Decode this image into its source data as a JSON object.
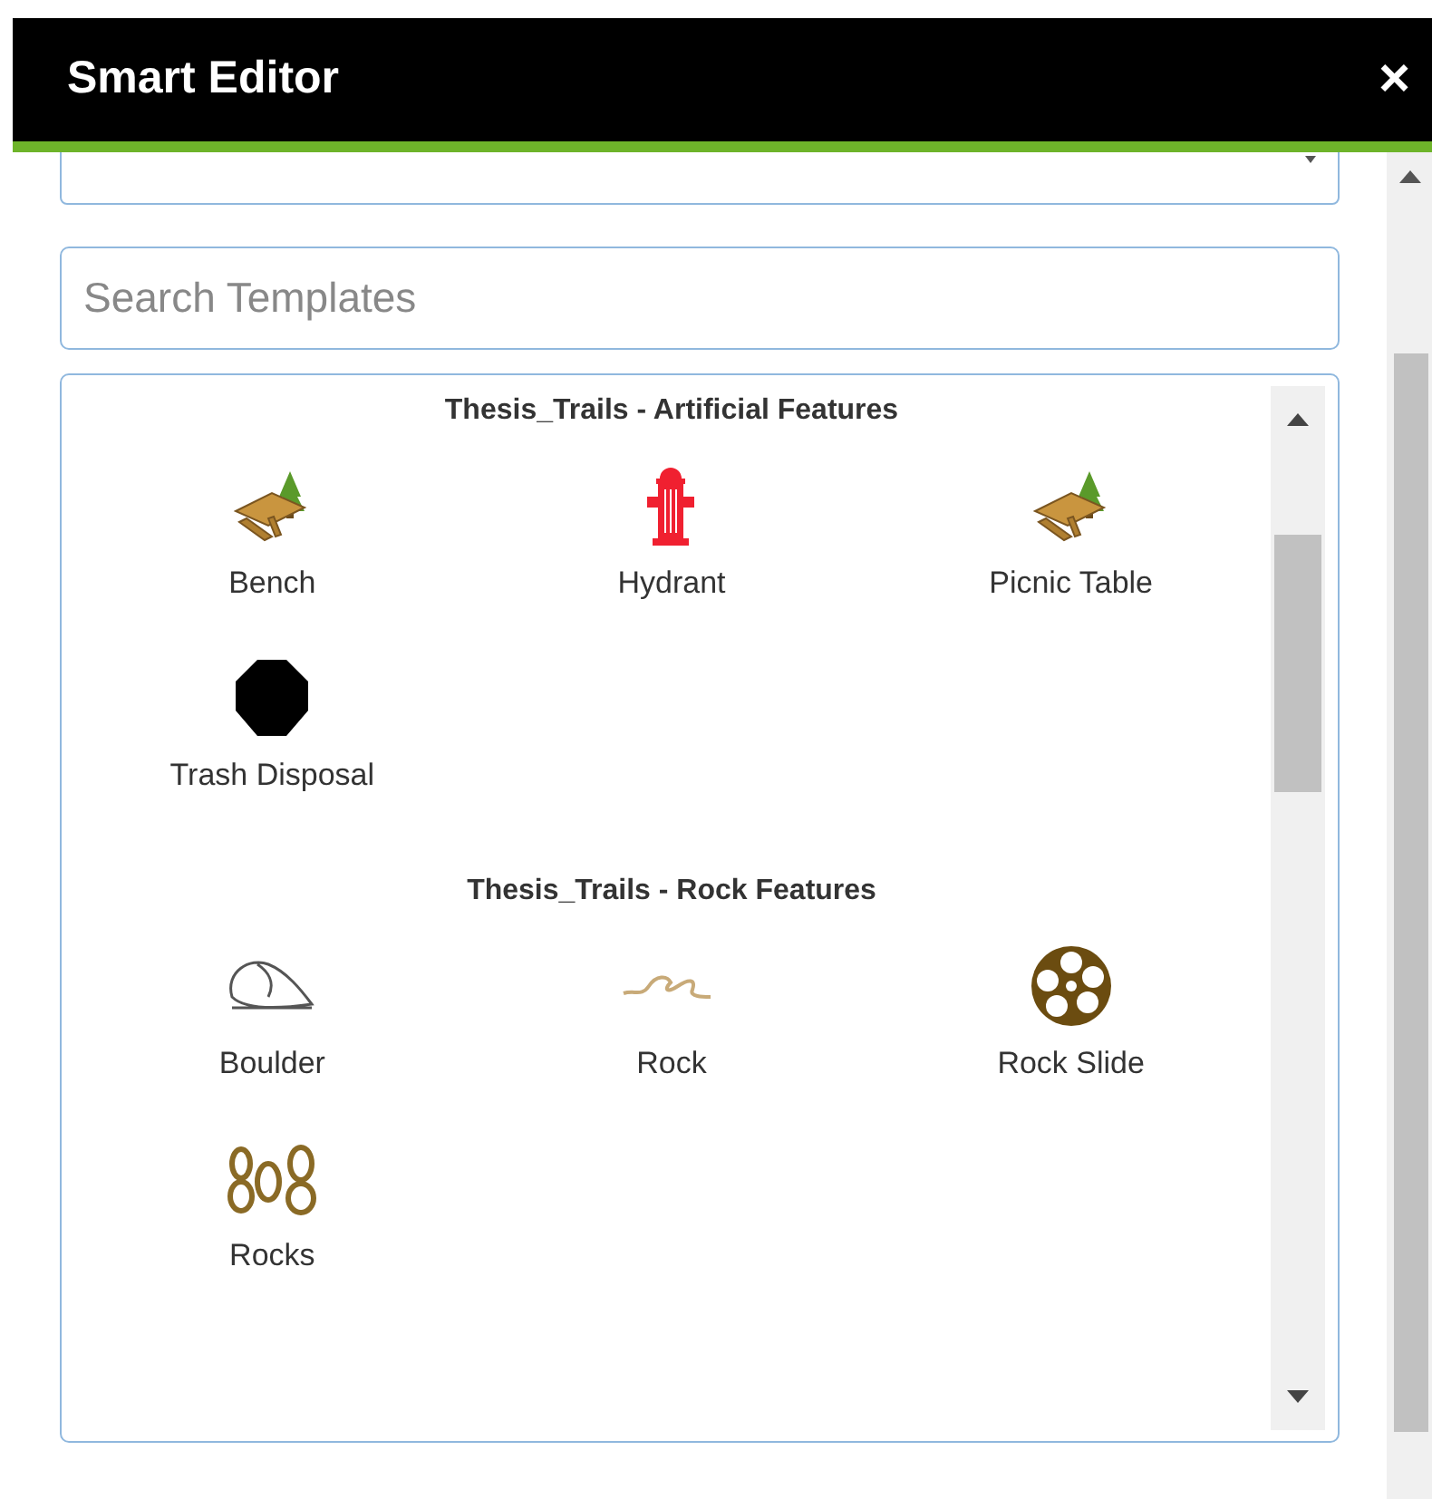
{
  "window": {
    "title": "Smart Editor",
    "close": "×"
  },
  "search": {
    "placeholder": "Search Templates"
  },
  "groups": [
    {
      "title": "Thesis_Trails - Artificial Features",
      "items": [
        {
          "label": "Bench",
          "kind": "picnic"
        },
        {
          "label": "Hydrant",
          "kind": "hydrant"
        },
        {
          "label": "Picnic Table",
          "kind": "picnic"
        },
        {
          "label": "Trash Disposal",
          "kind": "octagon"
        }
      ]
    },
    {
      "title": "Thesis_Trails - Rock Features",
      "items": [
        {
          "label": "Boulder",
          "kind": "boulder"
        },
        {
          "label": "Rock",
          "kind": "rock"
        },
        {
          "label": "Rock Slide",
          "kind": "rockslide"
        },
        {
          "label": "Rocks",
          "kind": "rocks"
        }
      ]
    }
  ]
}
